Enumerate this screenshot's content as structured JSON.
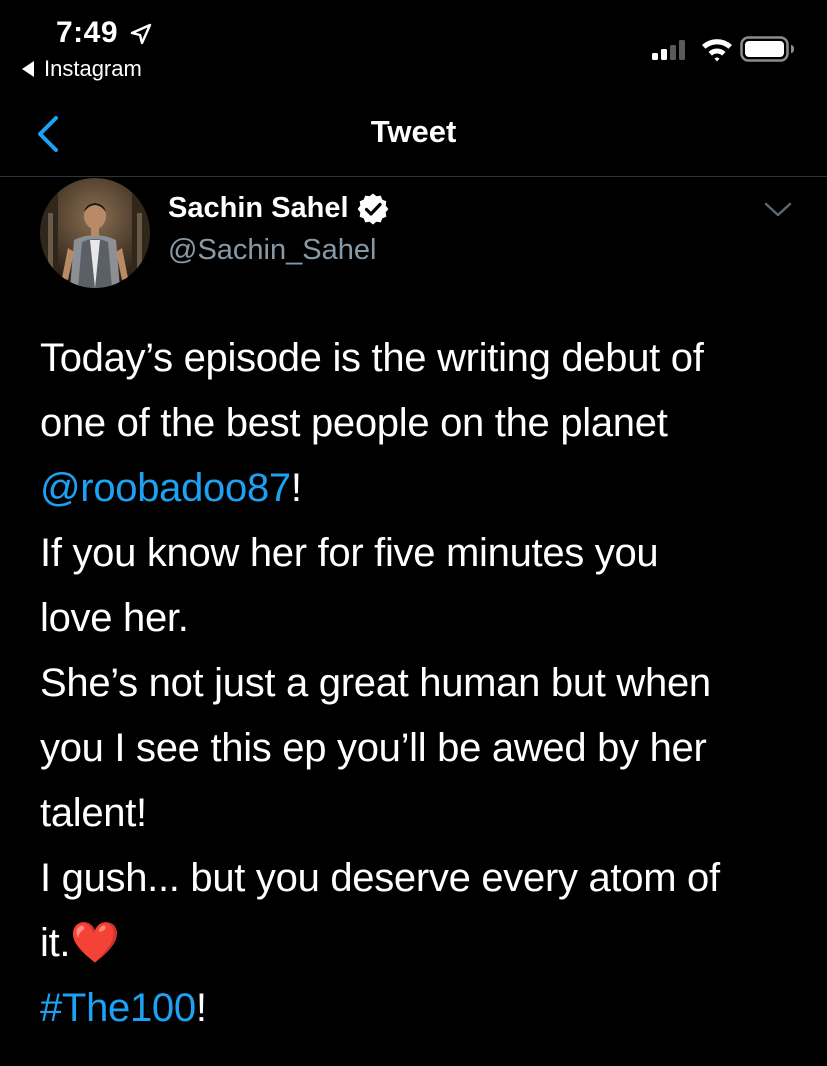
{
  "status_bar": {
    "time": "7:49",
    "back_app_label": "Instagram"
  },
  "nav": {
    "title": "Tweet"
  },
  "author": {
    "name": "Sachin Sahel",
    "handle": "@Sachin_Sahel"
  },
  "tweet": {
    "line1": "Today’s episode is the writing debut of",
    "line2": "one of the best people on the planet",
    "mention": "@roobadoo87",
    "mention_suffix": "!",
    "line4": "If you know her for five minutes you",
    "line5": "love her.",
    "line6": "She’s not just a great human but when",
    "line7": "you I see this ep you’ll be awed by her",
    "line8": "talent!",
    "line9": "I gush... but you deserve every atom of",
    "line10": "it.",
    "emoji": "❤️",
    "hashtag": "#The100",
    "hashtag_suffix": "!"
  },
  "colors": {
    "background": "#000000",
    "link": "#1da1f2",
    "handle": "#8899a6",
    "divider": "#2f3336"
  },
  "icons": {
    "location": "location-arrow-icon",
    "back_app": "back-triangle-icon",
    "signal": "cellular-signal-icon",
    "wifi": "wifi-icon",
    "battery": "battery-icon",
    "nav_back": "chevron-left-icon",
    "verified": "verified-badge-icon",
    "more": "chevron-down-icon"
  }
}
